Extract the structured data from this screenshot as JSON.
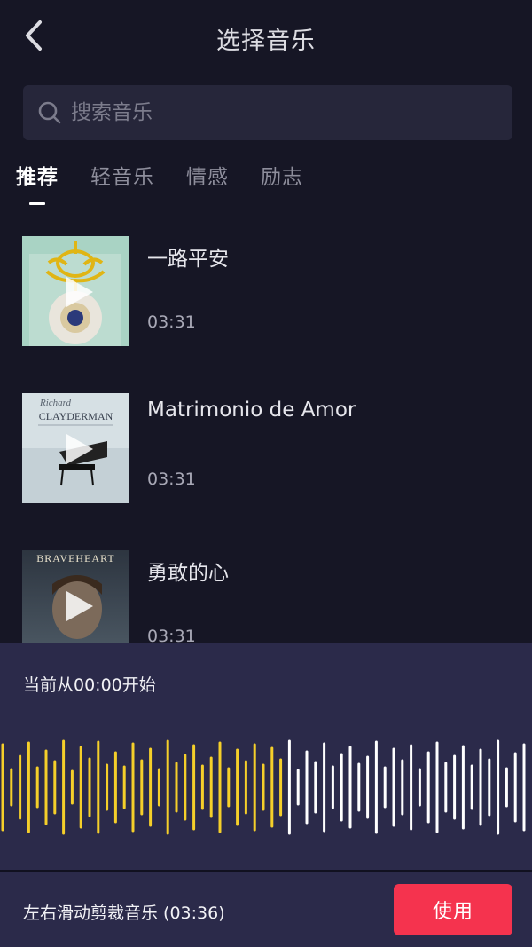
{
  "header": {
    "title": "选择音乐",
    "back_icon": "chevron-left-icon"
  },
  "search": {
    "placeholder": "搜索音乐",
    "icon": "search-icon"
  },
  "tabs": [
    {
      "label": "推荐",
      "active": true
    },
    {
      "label": "轻音乐",
      "active": false
    },
    {
      "label": "情感",
      "active": false
    },
    {
      "label": "励志",
      "active": false
    }
  ],
  "songs": [
    {
      "title": "一路平安",
      "duration": "03:31",
      "cover": "chinese-knot-album-cover"
    },
    {
      "title": "Matrimonio de Amor",
      "duration": "03:31",
      "cover": "clayderman-piano-album-cover",
      "cover_text": "CLAYDERMAN"
    },
    {
      "title": "勇敢的心",
      "duration": "03:31",
      "cover": "braveheart-album-cover",
      "cover_text": "BRAVEHEART"
    }
  ],
  "trim_panel": {
    "start_text": "当前从00:00开始",
    "hint_text": "左右滑动剪裁音乐 (03:36)",
    "use_label": "使用",
    "played_color": "#f5cf2a",
    "unplayed_color": "#ffffff",
    "accent_color": "#f5334e"
  }
}
